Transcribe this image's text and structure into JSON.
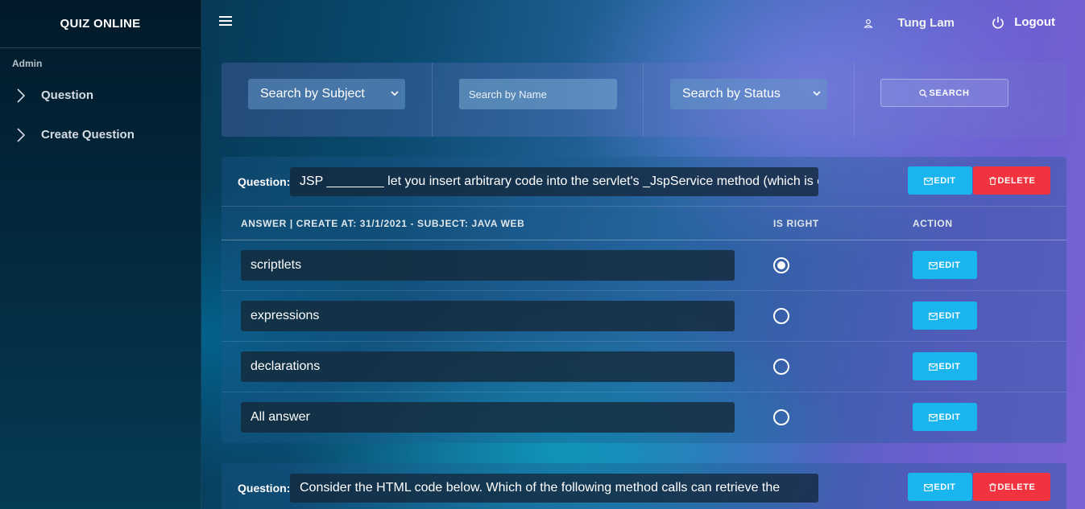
{
  "sidebar": {
    "brand": "QUIZ ONLINE",
    "section": "Admin",
    "items": [
      {
        "label": "Question"
      },
      {
        "label": "Create Question"
      }
    ]
  },
  "header": {
    "user_name": "Tung Lam",
    "logout_label": "Logout"
  },
  "filters": {
    "subject": "Search by Subject",
    "name_placeholder": "Search by Name",
    "status": "Search by Status",
    "search_label": "SEARCH"
  },
  "questions": [
    {
      "label": "Question:",
      "text": "JSP ________ let you insert arbitrary code into the servlet's _JspService method (which is c",
      "edit_label": "EDIT",
      "delete_label": "DELETE",
      "table": {
        "col_answer": "ANSWER | CREATE AT: 31/1/2021 - SUBJECT: JAVA WEB",
        "col_right": "IS RIGHT",
        "col_action": "ACTION"
      },
      "answers": [
        {
          "text": "scriptlets",
          "is_right": true,
          "edit_label": "EDIT"
        },
        {
          "text": "expressions",
          "is_right": false,
          "edit_label": "EDIT"
        },
        {
          "text": "declarations",
          "is_right": false,
          "edit_label": "EDIT"
        },
        {
          "text": "All answer",
          "is_right": false,
          "edit_label": "EDIT"
        }
      ]
    },
    {
      "label": "Question:",
      "text": "Consider the HTML code below. Which of the following method calls can retrieve the",
      "edit_label": "EDIT",
      "delete_label": "DELETE"
    }
  ],
  "colors": {
    "edit_button": "#1ab4ee",
    "delete_button": "#f0333f"
  },
  "icons": [
    "hamburger-icon",
    "chevron-right-icon",
    "user-icon",
    "power-icon",
    "search-icon",
    "edit-icon",
    "trash-icon",
    "dropdown-arrow-icon"
  ]
}
